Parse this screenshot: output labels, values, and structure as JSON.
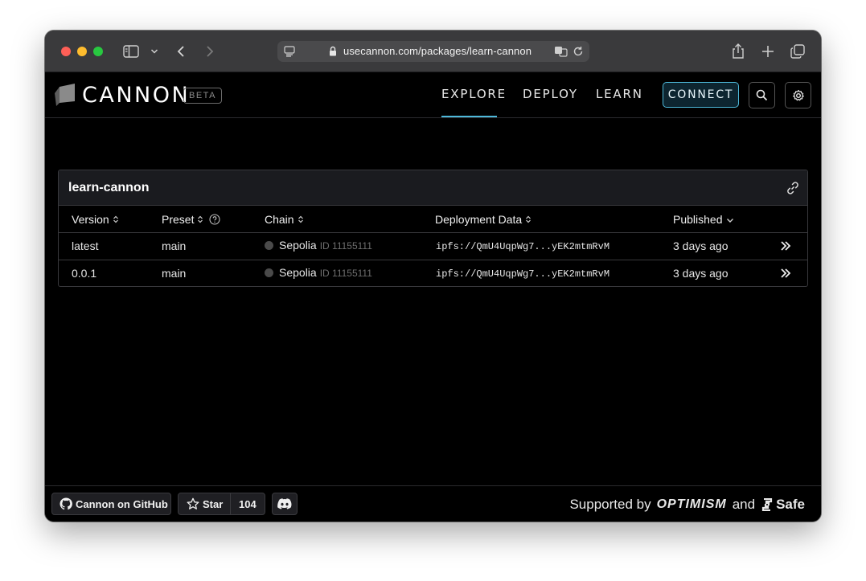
{
  "browser": {
    "url": "usecannon.com/packages/learn-cannon"
  },
  "header": {
    "logo_text": "CANNON",
    "beta_label": "BETA",
    "nav": [
      {
        "label": "EXPLORE",
        "active": true
      },
      {
        "label": "DEPLOY",
        "active": false
      },
      {
        "label": "LEARN",
        "active": false
      }
    ],
    "connect_label": "CONNECT",
    "accent_color": "#4db8d9"
  },
  "package": {
    "name": "learn-cannon",
    "columns": [
      "Version",
      "Preset",
      "Chain",
      "Deployment Data",
      "Published"
    ],
    "rows": [
      {
        "version": "latest",
        "preset": "main",
        "chain_name": "Sepolia",
        "chain_id": "ID 11155111",
        "deployment": "ipfs://QmU4UqpWg7...yEK2mtmRvM",
        "published": "3 days ago"
      },
      {
        "version": "0.0.1",
        "preset": "main",
        "chain_name": "Sepolia",
        "chain_id": "ID 11155111",
        "deployment": "ipfs://QmU4UqpWg7...yEK2mtmRvM",
        "published": "3 days ago"
      }
    ]
  },
  "footer": {
    "github_label": "Cannon on GitHub",
    "star_label": "Star",
    "star_count": "104",
    "supported_by": "Supported by",
    "optimism": "OPTIMISM",
    "and": "and",
    "safe": "Safe"
  }
}
